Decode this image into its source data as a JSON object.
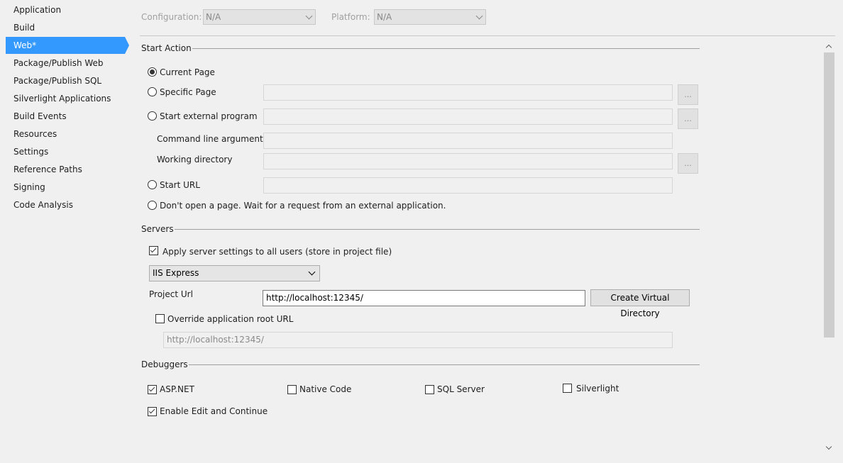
{
  "sidebar": {
    "items": [
      {
        "label": "Application"
      },
      {
        "label": "Build"
      },
      {
        "label": "Web*"
      },
      {
        "label": "Package/Publish Web"
      },
      {
        "label": "Package/Publish SQL"
      },
      {
        "label": "Silverlight Applications"
      },
      {
        "label": "Build Events"
      },
      {
        "label": "Resources"
      },
      {
        "label": "Settings"
      },
      {
        "label": "Reference Paths"
      },
      {
        "label": "Signing"
      },
      {
        "label": "Code Analysis"
      }
    ],
    "active_color": "#3399ff"
  },
  "config": {
    "configuration_label": "Configuration:",
    "configuration_value": "N/A",
    "platform_label": "Platform:",
    "platform_value": "N/A"
  },
  "start_action": {
    "title": "Start Action",
    "current_page": "Current Page",
    "specific_page": "Specific Page",
    "start_external_program": "Start external program",
    "command_line_arguments": "Command line arguments",
    "working_directory": "Working directory",
    "start_url": "Start URL",
    "dont_open": "Don't open a page.  Wait for a request from an external application.",
    "browse": "...",
    "selected": "current_page"
  },
  "servers": {
    "title": "Servers",
    "apply_settings": "Apply server settings to all users (store in project file)",
    "apply_checked": true,
    "server_type": "IIS Express",
    "project_url_label": "Project Url",
    "project_url": "http://localhost:12345/",
    "create_virtual_directory": "Create Virtual Directory",
    "override_root": "Override application root URL",
    "override_checked": false,
    "override_url": "http://localhost:12345/"
  },
  "debuggers": {
    "title": "Debuggers",
    "aspnet": "ASP.NET",
    "aspnet_checked": true,
    "native_code": "Native Code",
    "native_checked": false,
    "sql_server": "SQL Server",
    "sql_checked": false,
    "silverlight": "Silverlight",
    "silverlight_checked": false,
    "edit_continue": "Enable Edit and Continue",
    "edit_continue_checked": true
  }
}
